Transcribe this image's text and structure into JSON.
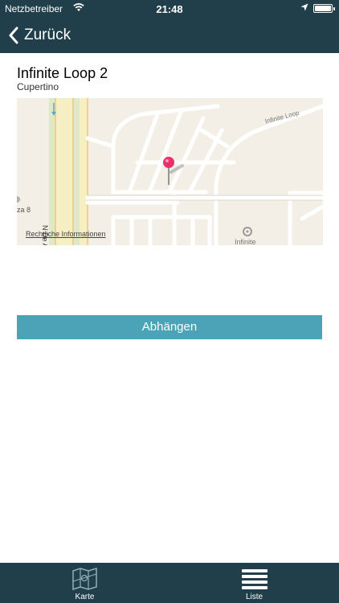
{
  "status_bar": {
    "carrier": "Netzbetreiber",
    "time": "21:48",
    "icons": [
      "wifi-icon",
      "location-arrow-icon",
      "battery-icon"
    ]
  },
  "nav": {
    "back_label": "Zurück",
    "back_icon": "chevron-left-icon"
  },
  "location": {
    "title": "Infinite Loop 2",
    "subtitle": "Cupertino"
  },
  "map": {
    "road_label": "Infinite Loop",
    "street_label": "N De A",
    "poi_label": "Infinite",
    "plaza_label": "za 8",
    "legal_link": "Rechtliche Informationen",
    "pin_color": "#e8306a",
    "background_color": "#f3efe6"
  },
  "action_button": {
    "label": "Abhängen",
    "color": "#4ba3b7"
  },
  "tab_bar": {
    "tabs": [
      {
        "label": "Karte",
        "icon": "map-icon"
      },
      {
        "label": "Liste",
        "icon": "list-icon"
      }
    ]
  },
  "theme": {
    "bar_color": "#203f4a"
  }
}
